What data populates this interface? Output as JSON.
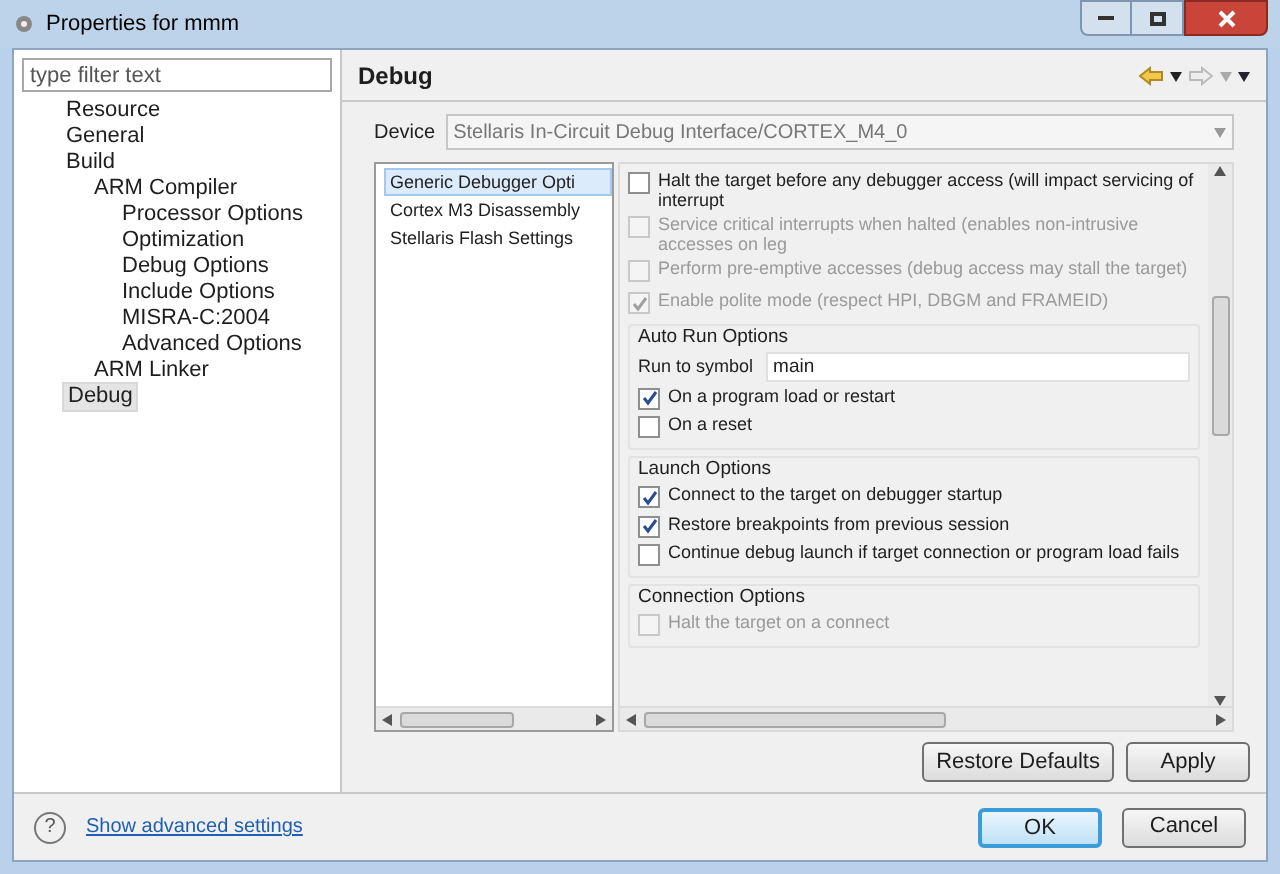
{
  "window": {
    "title": "Properties for mmm"
  },
  "filter": {
    "placeholder": "type filter text"
  },
  "tree": [
    {
      "label": "Resource",
      "selected": false
    },
    {
      "label": "General",
      "selected": false
    },
    {
      "label": "Build",
      "selected": false,
      "children": [
        {
          "label": "ARM Compiler",
          "selected": false,
          "children": [
            {
              "label": "Processor Options",
              "selected": false
            },
            {
              "label": "Optimization",
              "selected": false
            },
            {
              "label": "Debug Options",
              "selected": false
            },
            {
              "label": "Include Options",
              "selected": false
            },
            {
              "label": "MISRA-C:2004",
              "selected": false
            },
            {
              "label": "Advanced Options",
              "selected": false
            }
          ]
        },
        {
          "label": "ARM Linker",
          "selected": false
        }
      ]
    },
    {
      "label": "Debug",
      "selected": true
    }
  ],
  "page": {
    "title": "Debug"
  },
  "device": {
    "label": "Device",
    "value": "Stellaris In-Circuit Debug Interface/CORTEX_M4_0"
  },
  "sections": [
    {
      "label": "Generic Debugger Opti",
      "selected": true
    },
    {
      "label": "Cortex M3 Disassembly",
      "selected": false
    },
    {
      "label": "Stellaris Flash Settings",
      "selected": false
    }
  ],
  "options": [
    {
      "label": "Halt the target before any debugger access (will impact servicing of interrupt",
      "checked": false,
      "disabled": false
    },
    {
      "label": "Service critical interrupts when halted (enables non-intrusive accesses on leg",
      "checked": false,
      "disabled": true
    },
    {
      "label": "Perform pre-emptive accesses (debug access may stall the target)",
      "checked": false,
      "disabled": true
    },
    {
      "label": "Enable polite mode (respect HPI, DBGM and FRAMEID)",
      "checked": true,
      "disabled": true
    }
  ],
  "groups": [
    {
      "title": "Auto Run Options",
      "items": [
        {
          "kind": "field",
          "label": "Run to symbol",
          "value": "main"
        },
        {
          "kind": "checkbox",
          "label": "On a program load or restart",
          "checked": true,
          "disabled": false
        },
        {
          "kind": "checkbox",
          "label": "On a reset",
          "checked": false,
          "disabled": false
        }
      ]
    },
    {
      "title": "Launch Options",
      "items": [
        {
          "kind": "checkbox",
          "label": "Connect to the target on debugger startup",
          "checked": true,
          "disabled": false
        },
        {
          "kind": "checkbox",
          "label": "Restore breakpoints from previous session",
          "checked": true,
          "disabled": false
        },
        {
          "kind": "checkbox",
          "label": "Continue debug launch if target connection or program load fails",
          "checked": false,
          "disabled": false
        }
      ]
    },
    {
      "title": "Connection Options",
      "items": [
        {
          "kind": "checkbox",
          "label": "Halt the target on a connect",
          "checked": false,
          "disabled": true
        }
      ]
    }
  ],
  "page_buttons": [
    "Restore Defaults",
    "Apply"
  ],
  "footer": {
    "help": "?",
    "link": "Show advanced settings",
    "buttons": [
      {
        "label": "OK",
        "default": true
      },
      {
        "label": "Cancel",
        "default": false
      }
    ]
  }
}
